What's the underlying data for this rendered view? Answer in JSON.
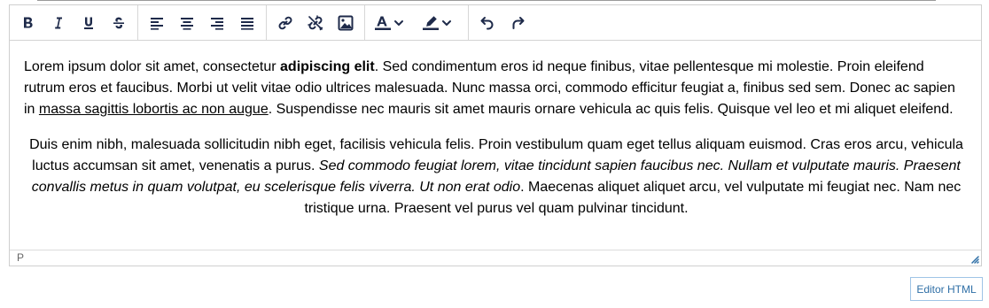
{
  "toolbar": {
    "buttons": [
      {
        "icon": "bold-icon",
        "label": "Bold"
      },
      {
        "icon": "italic-icon",
        "label": "Italic"
      },
      {
        "icon": "underline-icon",
        "label": "Underline"
      },
      {
        "icon": "strikethrough-icon",
        "label": "Strikethrough"
      },
      {
        "icon": "align-left-icon",
        "label": "Align left"
      },
      {
        "icon": "align-center-icon",
        "label": "Align center"
      },
      {
        "icon": "align-right-icon",
        "label": "Align right"
      },
      {
        "icon": "align-justify-icon",
        "label": "Justify"
      },
      {
        "icon": "link-icon",
        "label": "Insert link"
      },
      {
        "icon": "unlink-icon",
        "label": "Remove link"
      },
      {
        "icon": "image-icon",
        "label": "Insert image"
      },
      {
        "icon": "text-color-icon",
        "label": "Text color"
      },
      {
        "icon": "highlight-color-icon",
        "label": "Background color"
      },
      {
        "icon": "undo-icon",
        "label": "Undo"
      },
      {
        "icon": "redo-icon",
        "label": "Redo"
      }
    ]
  },
  "content": {
    "p1": {
      "a": "Lorem ipsum dolor sit amet, consectetur ",
      "bold": "adipiscing elit",
      "b": ". Sed condimentum eros id neque finibus, vitae pellentesque mi molestie. Proin eleifend rutrum eros et faucibus. Morbi ut velit vitae odio ultrices malesuada. Nunc massa orci, commodo efficitur feugiat a, finibus sed sem. Donec ac sapien in ",
      "underline": "massa sagittis lobortis ac non augue",
      "c": ". Suspendisse nec mauris sit amet mauris ornare vehicula ac quis felis. Quisque vel leo et mi aliquet eleifend."
    },
    "p2": {
      "a": "Duis enim nibh, malesuada sollicitudin nibh eget, facilisis vehicula felis. Proin vestibulum quam eget tellus aliquam euismod. Cras eros arcu, vehicula luctus accumsan sit amet, venenatis a purus. ",
      "italic": "Sed commodo feugiat lorem, vitae tincidunt sapien faucibus nec. Nullam et vulputate mauris. Praesent convallis metus in quam volutpat, eu scelerisque felis viverra. Ut non erat odio",
      "b": ". Maecenas aliquet aliquet arcu, vel vulputate mi feugiat nec. Nam nec tristique urna. Praesent vel purus vel quam pulvinar tincidunt."
    }
  },
  "statusbar": {
    "path": "P"
  },
  "footer": {
    "html_button": "Editor HTML"
  },
  "colors": {
    "icon": "#1e2a4a",
    "accent": "#2f6fa6",
    "border": "#cfcfcf"
  }
}
